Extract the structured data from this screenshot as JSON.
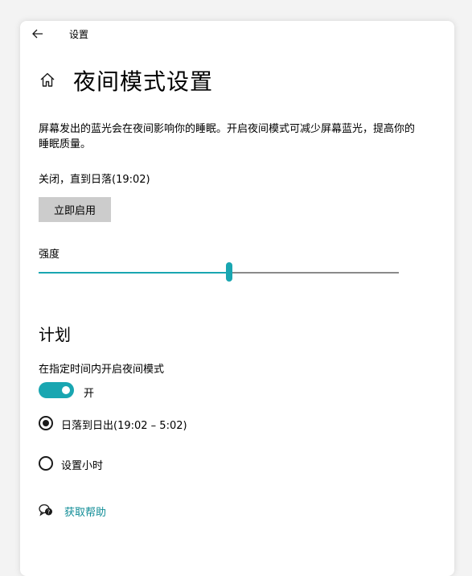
{
  "window": {
    "title": "设置"
  },
  "page": {
    "title": "夜间模式设置"
  },
  "description": "屏幕发出的蓝光会在夜间影响你的睡眠。开启夜间模式可减少屏幕蓝光，提高你的睡眠质量。",
  "status_text": "关闭，直到日落(19:02)",
  "enable_button_label": "立即启用",
  "strength": {
    "label": "强度",
    "value_percent": 53
  },
  "schedule": {
    "section_title": "计划",
    "toggle_label": "在指定时间内开启夜间模式",
    "toggle_on": true,
    "toggle_state_text": "开",
    "options": [
      {
        "label": "日落到日出(19:02 – 5:02)",
        "selected": true
      },
      {
        "label": "设置小时",
        "selected": false
      }
    ]
  },
  "help": {
    "link_text": "获取帮助"
  },
  "colors": {
    "accent": "#19a6b1",
    "link": "#0f8c96",
    "button_bg": "#cccccc",
    "background": "#ffffff"
  },
  "icons": {
    "back": "back-arrow-icon",
    "home": "home-icon",
    "help": "help-chat-icon"
  }
}
